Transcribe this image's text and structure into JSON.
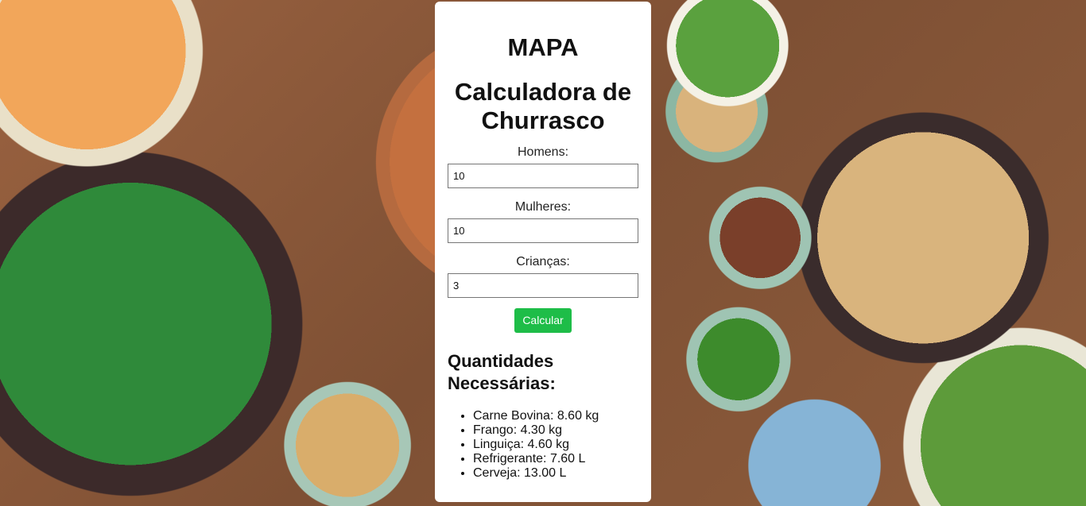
{
  "header": {
    "title": "MAPA",
    "subtitle": "Calculadora de Churrasco"
  },
  "form": {
    "men": {
      "label": "Homens:",
      "value": "10"
    },
    "women": {
      "label": "Mulheres:",
      "value": "10"
    },
    "children": {
      "label": "Crianças:",
      "value": "3"
    },
    "submit_label": "Calcular"
  },
  "results": {
    "title": "Quantidades Necessárias:",
    "items": [
      {
        "text": "Carne Bovina: 8.60 kg"
      },
      {
        "text": "Frango: 4.30 kg"
      },
      {
        "text": "Linguiça: 4.60 kg"
      },
      {
        "text": "Refrigerante: 7.60 L"
      },
      {
        "text": "Cerveja: 13.00 L"
      }
    ]
  },
  "colors": {
    "card_background": "#ffffff",
    "button_background": "#1ebd48"
  }
}
